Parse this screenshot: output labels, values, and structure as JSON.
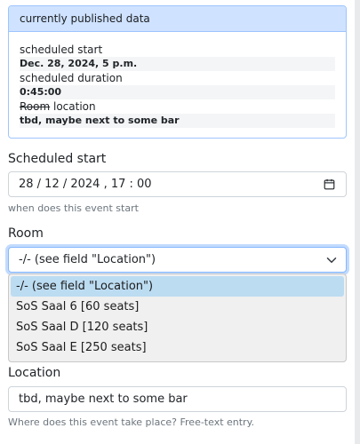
{
  "published": {
    "header": "currently published data",
    "start_label": "scheduled start",
    "start_value": "Dec. 28, 2024, 5 p.m.",
    "duration_label": "scheduled duration",
    "duration_value": "0:45:00",
    "room_label_struck": "Room",
    "location_label": "location",
    "location_value": "tbd, maybe next to some bar"
  },
  "start": {
    "label": "Scheduled start",
    "value": "28 / 12 / 2024 ,  17 : 00",
    "help": "when does this event start"
  },
  "room": {
    "label": "Room",
    "selected": "-/- (see field \"Location\")",
    "options": [
      "-/- (see field \"Location\")",
      "SoS Saal 6 [60 seats]",
      "SoS Saal D [120 seats]",
      "SoS Saal E [250 seats]"
    ]
  },
  "location": {
    "label": "Location",
    "value": "tbd, maybe next to some bar",
    "help": "Where does this event take place? Free-text entry."
  }
}
